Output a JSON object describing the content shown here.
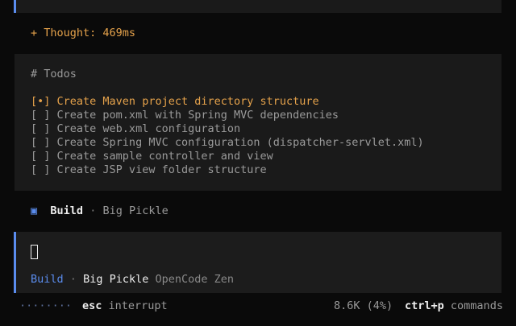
{
  "thought": {
    "label": "+ Thought: 469ms"
  },
  "todos": {
    "title": "# Todos",
    "items": [
      {
        "checkbox": "[•]",
        "text": "Create Maven project directory structure",
        "status": "in_progress"
      },
      {
        "checkbox": "[ ]",
        "text": "Create pom.xml with Spring MVC dependencies",
        "status": "pending"
      },
      {
        "checkbox": "[ ]",
        "text": "Create web.xml configuration",
        "status": "pending"
      },
      {
        "checkbox": "[ ]",
        "text": "Create Spring MVC configuration (dispatcher-servlet.xml)",
        "status": "pending"
      },
      {
        "checkbox": "[ ]",
        "text": "Create sample controller and view",
        "status": "pending"
      },
      {
        "checkbox": "[ ]",
        "text": "Create JSP view folder structure",
        "status": "pending"
      }
    ]
  },
  "agent_line": {
    "icon": "▣",
    "agent": "Build",
    "separator": "·",
    "model": "Big Pickle"
  },
  "input": {
    "mode_agent": "Build",
    "separator": "·",
    "model": "Big Pickle",
    "provider": "OpenCode Zen"
  },
  "status_bar": {
    "spinner": "········",
    "interrupt_key": "esc",
    "interrupt_label": "interrupt",
    "tokens": "8.6K (4%)",
    "commands_key": "ctrl+p",
    "commands_label": "commands"
  },
  "colors": {
    "accent": "#5b8def",
    "highlight": "#e5a24b",
    "background": "#0a0a0a",
    "panel": "#1a1a1a"
  }
}
